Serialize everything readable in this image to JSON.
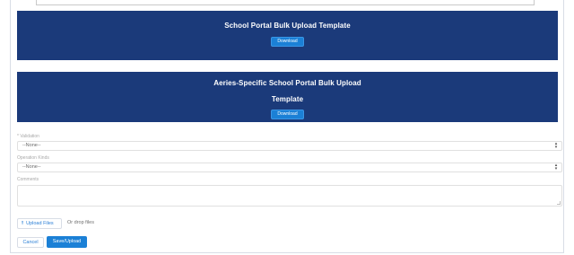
{
  "templates": [
    {
      "title_lines": [
        "School Portal Bulk Upload Template"
      ],
      "button_label": "Download"
    },
    {
      "title_lines": [
        "Aeries-Specific School Portal Bulk Upload",
        "Template"
      ],
      "button_label": "Download"
    }
  ],
  "form": {
    "field1": {
      "label": "* Validation",
      "value": "--None--"
    },
    "field2": {
      "label": "Operation Kinds",
      "value": "--None--"
    },
    "comments": {
      "label": "Comments",
      "value": ""
    }
  },
  "upload": {
    "button_label": "Upload Files",
    "drop_text": "Or drop files"
  },
  "actions": {
    "cancel_label": "Cancel",
    "save_label": "Save/Upload"
  }
}
